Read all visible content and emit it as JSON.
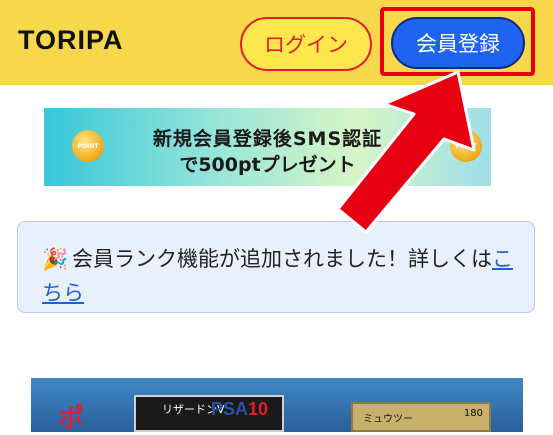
{
  "header": {
    "logo": "TORIPA",
    "login_label": "ログイン",
    "register_label": "会員登録"
  },
  "promo": {
    "line1": "新規会員登録後SMS認証",
    "line2": "で500ptプレゼント",
    "coin_label": "POINT"
  },
  "notice": {
    "emoji": "🎉",
    "text": "会員ランク機能が追加されました！詳しくは",
    "link": "こちら"
  },
  "card_banner": {
    "badge": "ポ",
    "card1_name": "リザードンV",
    "card1_grade_brand": "PSA",
    "card1_grade_num": "10",
    "card2_name": "ミュウツー",
    "card2_hp": "180"
  },
  "colors": {
    "header_bg": "#f7d84a",
    "login_border": "#e21e2b",
    "register_bg": "#1e64f0",
    "highlight_red": "#e60012"
  }
}
